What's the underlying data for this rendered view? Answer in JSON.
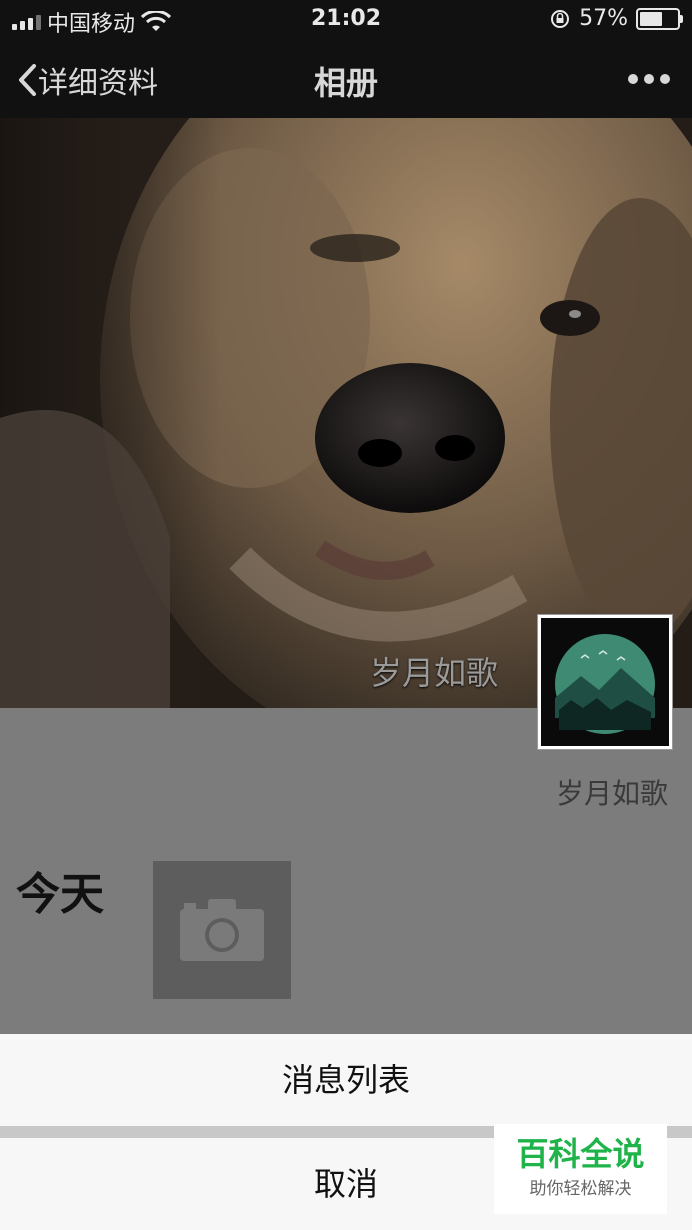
{
  "status_bar": {
    "carrier": "中国移动",
    "time": "21:02",
    "battery": "57%"
  },
  "nav": {
    "back_label": "详细资料",
    "title": "相册"
  },
  "cover": {
    "caption": "岁月如歌"
  },
  "profile": {
    "name": "岁月如歌"
  },
  "timeline": {
    "today_label": "今天"
  },
  "action_sheet": {
    "items": [
      {
        "label": "消息列表"
      },
      {
        "label": "取消"
      }
    ]
  },
  "watermark": {
    "title": "百科全说",
    "subtitle": "助你轻松解决"
  }
}
